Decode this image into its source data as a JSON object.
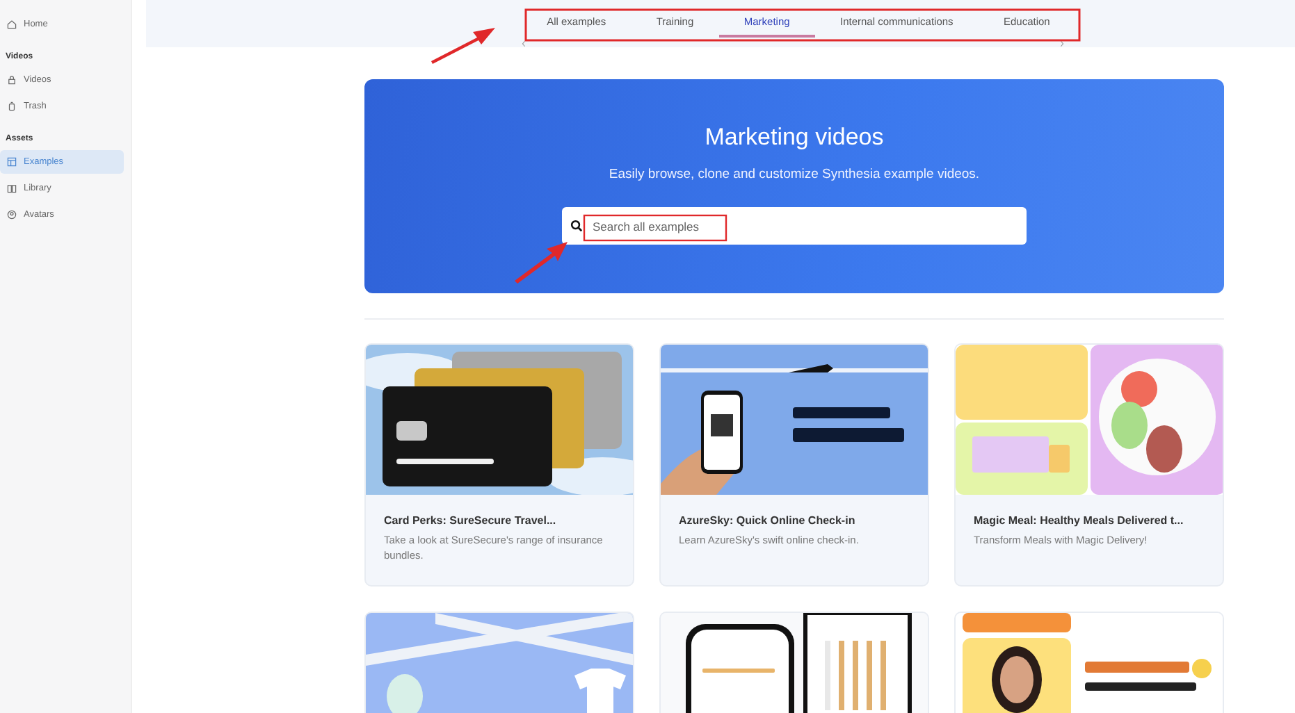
{
  "sidebar": {
    "sections": [
      {
        "items": [
          {
            "label": "Home",
            "selected": false
          }
        ]
      },
      {
        "heading": "Videos",
        "items": [
          {
            "label": "Videos",
            "selected": false
          },
          {
            "label": "Trash",
            "selected": false
          }
        ]
      },
      {
        "heading": "Assets",
        "items": [
          {
            "label": "Examples",
            "selected": true
          },
          {
            "label": "Library",
            "selected": false
          },
          {
            "label": "Avatars",
            "selected": false
          }
        ]
      }
    ]
  },
  "tabs": [
    {
      "label": "All examples",
      "selected": false
    },
    {
      "label": "Training",
      "selected": false
    },
    {
      "label": "Marketing",
      "selected": true
    },
    {
      "label": "Internal communications",
      "selected": false
    },
    {
      "label": "Education",
      "selected": false
    }
  ],
  "hero": {
    "title": "Marketing videos",
    "subtitle": "Easily browse, clone and customize Synthesia example videos.",
    "search": {
      "placeholder": "Search all examples"
    }
  },
  "cards": [
    {
      "kind": "picture",
      "title": "Card Perks: SureSecure Travel...",
      "description": "Take a look at SureSecure's range of insurance bundles."
    },
    {
      "kind": "picture",
      "title": "AzureSky: Quick Online Check-in",
      "description": "Learn AzureSky's swift online check-in."
    },
    {
      "kind": "picture",
      "title": "Magic Meal: Healthy Meals Delivered t...",
      "description": "Transform Meals with Magic Delivery!"
    },
    {
      "kind": "picture"
    },
    {
      "kind": "picture"
    },
    {
      "kind": "picture"
    }
  ]
}
